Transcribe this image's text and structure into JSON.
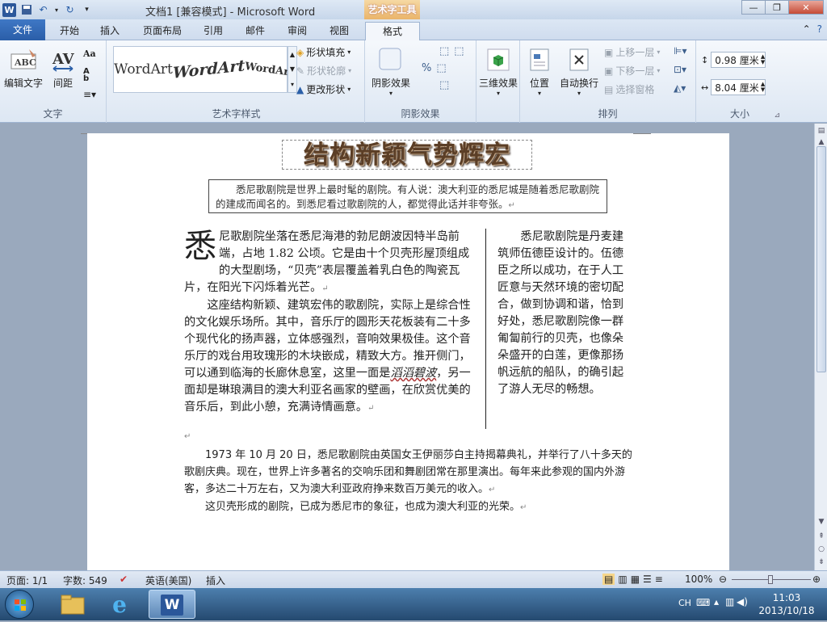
{
  "window": {
    "title": "文档1 [兼容模式] - Microsoft Word",
    "context_tab_header": "艺术字工具"
  },
  "tabs": [
    {
      "label": "文件"
    },
    {
      "label": "开始"
    },
    {
      "label": "插入"
    },
    {
      "label": "页面布局"
    },
    {
      "label": "引用"
    },
    {
      "label": "邮件"
    },
    {
      "label": "审阅"
    },
    {
      "label": "视图"
    },
    {
      "label": "格式"
    }
  ],
  "ribbon": {
    "text_group": {
      "label": "文字",
      "edit_text": "编辑文字",
      "spacing": "间距"
    },
    "wordart_styles": {
      "label": "艺术字样式",
      "samples": [
        "WordArt",
        "WordArt",
        "WordArt"
      ],
      "shape_fill": "形状填充",
      "shape_outline": "形状轮廓",
      "change_shape": "更改形状"
    },
    "shadow": {
      "label": "阴影效果",
      "shadow_effects": "阴影效果"
    },
    "threed": {
      "label": "",
      "effects": "三维效果"
    },
    "arrange": {
      "label": "排列",
      "position": "位置",
      "wrap": "自动换行",
      "bring_forward": "上移一层",
      "send_backward": "下移一层",
      "selection_pane": "选择窗格"
    },
    "size": {
      "label": "大小",
      "height": "0.98 厘米",
      "width": "8.04 厘米"
    }
  },
  "document": {
    "wordart_title": "结构新颖气势辉宏",
    "intro": "悉尼歌剧院是世界上最时髦的剧院。有人说：澳大利亚的悉尼城是随着悉尼歌剧院的建成而闻名的。到悉尼看过歌剧院的人，都觉得此话并非夸张。",
    "dropcap": "悉",
    "col_left_p1": "尼歌剧院坐落在悉尼海港的勃尼朗波因特半岛前端，占地 1.82 公顷。它是由十个贝壳形屋顶组成的大型剧场，“贝壳”表层覆盖着乳白色的陶瓷瓦片，在阳光下闪烁着光芒。",
    "col_left_p2a": "这座结构新颖、建筑宏伟的歌剧院，实际上是综合性的文化娱乐场所。其中，音乐厅的圆形天花板装有二十多个现代化的扬声器，立体感强烈，音响效果极佳。这个音乐厅的戏台用玫瑰形的木块嵌成，精致大方。推开侧门，可以通到临海的长廊休息室，这里一面是",
    "col_left_p2_styled": "滔滔碧波",
    "col_left_p2b": "，另一面却是琳琅满目的澳大利亚名画家的壁画，在欣赏优美的音乐后，到此小憩，充满诗情画意。",
    "col_right": "悉尼歌剧院是丹麦建筑师伍德臣设计的。伍德臣之所以成功，在于人工匠意与天然环境的密切配合，做到协调和谐，恰到好处，悉尼歌剧院像一群匍匐前行的贝壳，也像朵朵盛开的白莲，更像那扬帆远航的船队，的确引起了游人无尽的畅想。",
    "bottom_p1": "1973 年 10 月 20 日，悉尼歌剧院由英国女王伊丽莎白主持揭幕典礼，并举行了八十多天的歌剧庆典。现在，世界上许多著名的交响乐团和舞剧团常在那里演出。每年来此参观的国内外游客，多达二十万左右，又为澳大利亚政府挣来数百万美元的收入。",
    "bottom_p2": "这贝壳形成的剧院，已成为悉尼市的象征，也成为澳大利亚的光荣。",
    "para_mark": "↵"
  },
  "status": {
    "page": "页面: 1/1",
    "words": "字数: 549",
    "language": "英语(美国)",
    "mode": "插入",
    "zoom": "100%"
  },
  "taskbar": {
    "ime": "CH",
    "time": "11:03",
    "date": "2013/10/18"
  }
}
